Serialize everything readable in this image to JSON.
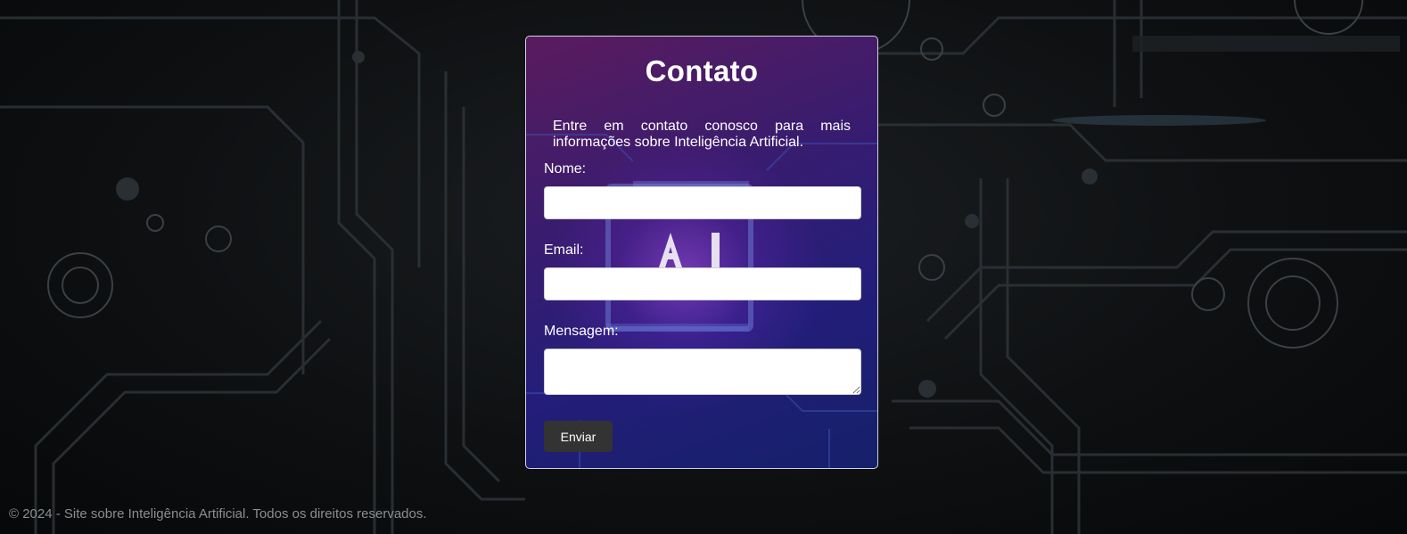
{
  "form": {
    "title": "Contato",
    "intro": "Entre em contato conosco para mais informações sobre Inteligência Artificial.",
    "name_label": "Nome:",
    "name_value": "",
    "email_label": "Email:",
    "email_value": "",
    "message_label": "Mensagem:",
    "message_value": "",
    "submit_label": "Enviar"
  },
  "footer": {
    "text": "© 2024 - Site sobre Inteligência Artificial. Todos os direitos reservados."
  },
  "colors": {
    "card_border": "#cfd2e6",
    "button_bg": "#333333",
    "footer_text": "#8a8e92",
    "accent_purple": "#7a2fc8",
    "accent_blue": "#1c2a8a"
  }
}
